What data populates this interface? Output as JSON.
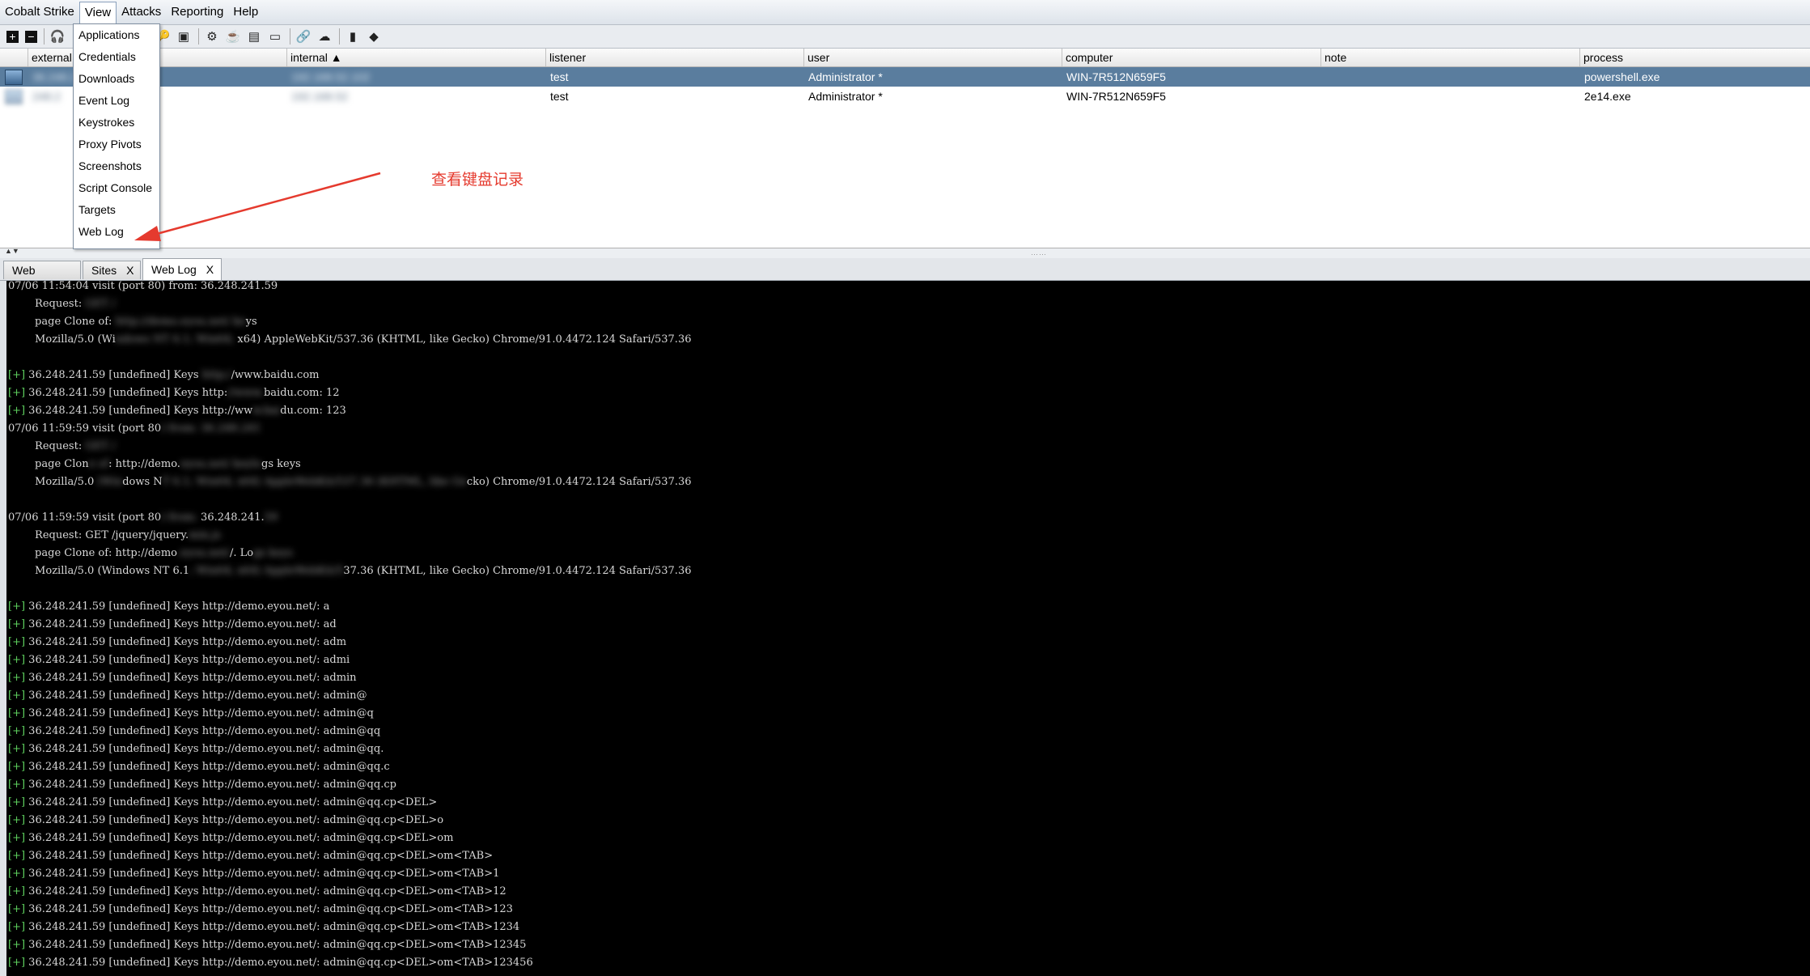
{
  "menubar": {
    "items": [
      "Cobalt Strike",
      "View",
      "Attacks",
      "Reporting",
      "Help"
    ],
    "active": "View"
  },
  "toolbar": {
    "icons": [
      "plus-icon",
      "minus-icon",
      "headphones-icon",
      "share-icon",
      "crosshair-icon",
      "list-icon",
      "download-icon",
      "key-icon",
      "image-icon",
      "gear-icon",
      "coffee-icon",
      "document-icon",
      "terminal-icon",
      "link-icon",
      "cloud-icon",
      "book-icon",
      "cube-icon"
    ]
  },
  "view_menu": {
    "items": [
      "Applications",
      "Credentials",
      "Downloads",
      "Event Log",
      "Keystrokes",
      "Proxy Pivots",
      "Screenshots",
      "Script Console",
      "Targets",
      "Web Log"
    ]
  },
  "sessions": {
    "columns": [
      "external",
      "internal ▲",
      "listener",
      "user",
      "computer",
      "note",
      "process"
    ],
    "rows": [
      {
        "external": "36.248.2",
        "internal": "192.168.52.102",
        "listener": "test",
        "user": "Administrator *",
        "computer": "WIN-7R512N659F5",
        "note": "",
        "process": "powershell.exe",
        "selected": true
      },
      {
        "external": "248.2",
        "internal": "192.168.52",
        "listener": "test",
        "user": "Administrator *",
        "computer": "WIN-7R512N659F5",
        "note": "",
        "process": "2e14.exe",
        "selected": false
      }
    ]
  },
  "tabs": [
    {
      "label": "Web Log",
      "close": "X"
    },
    {
      "label": "Sites",
      "close": "X"
    },
    {
      "label": "Web Log",
      "close": "X",
      "active": true
    }
  ],
  "annotation": {
    "text": "查看键盘记录",
    "color": "#e53a2e"
  },
  "console": {
    "lines": [
      {
        "t": "07/06 11:54:04 visit (port 80) from: 36.248.241.59"
      },
      {
        "t": "        Request: ",
        "b": "GET /"
      },
      {
        "t": "        page Clone of: ",
        "b": "http://demo.eyou.net/ ke",
        "s": "ys"
      },
      {
        "t": "        Mozilla/5.0 (Wi",
        "b": "ndows NT 6.1; Win64;",
        "s": " x64) AppleWebKit/537.36 (KHTML, like Gecko) Chrome/91.0.4472.124 Safari/537.36"
      },
      {
        "t": ""
      },
      {
        "p": "[+]",
        "t": " 36.248.241.59 [undefined] Keys ",
        "b": "http:/",
        "s": "/www.baidu.com"
      },
      {
        "p": "[+]",
        "t": " 36.248.241.59 [undefined] Keys http:",
        "b": "//www.",
        "s": "baidu.com: 12"
      },
      {
        "p": "[+]",
        "t": " 36.248.241.59 [undefined] Keys http://ww",
        "b": "w.bai",
        "s": "du.com: 123"
      },
      {
        "t": "07/06 11:59:59 visit (port 80",
        "b": ") from: 36.248.241",
        "s": ""
      },
      {
        "t": "        Request: ",
        "b": "GET /"
      },
      {
        "t": "        page Clon",
        "b": "e of",
        "s": ": http://demo.",
        "b2": "eyou.net/ keylo",
        "s2": "gs keys"
      },
      {
        "t": "        Mozilla/5.0 ",
        "b": "(Win",
        "s": "dows N",
        "b2": "T 6.1; Win64; x64) AppleWebKit/537.36 (KHTML, like Ge",
        "s2": "cko) Chrome/91.0.4472.124 Safari/537.36"
      },
      {
        "t": ""
      },
      {
        "t": "07/06 11:59:59 visit (port 80",
        "b": ") from: ",
        "s": "36.248.241.",
        "b2": "59"
      },
      {
        "t": "        Request: GET /jquery/jquery.",
        "b": "min.js"
      },
      {
        "t": "        page Clone of: http://demo",
        "b": ".eyou.net/",
        "s": "/. Lo",
        "b2": "gs keys"
      },
      {
        "t": "        Mozilla/5.0 (Windows NT 6.1",
        "b": "; Win64; x64) AppleWebKit/5",
        "s": "37.36 (KHTML, like Gecko) Chrome/91.0.4472.124 Safari/537.36"
      },
      {
        "t": ""
      },
      {
        "p": "[+]",
        "t": " 36.248.241.59 [undefined] Keys http://demo.eyou.net/: a"
      },
      {
        "p": "[+]",
        "t": " 36.248.241.59 [undefined] Keys http://demo.eyou.net/: ad"
      },
      {
        "p": "[+]",
        "t": " 36.248.241.59 [undefined] Keys http://demo.eyou.net/: adm"
      },
      {
        "p": "[+]",
        "t": " 36.248.241.59 [undefined] Keys http://demo.eyou.net/: admi"
      },
      {
        "p": "[+]",
        "t": " 36.248.241.59 [undefined] Keys http://demo.eyou.net/: admin"
      },
      {
        "p": "[+]",
        "t": " 36.248.241.59 [undefined] Keys http://demo.eyou.net/: admin@"
      },
      {
        "p": "[+]",
        "t": " 36.248.241.59 [undefined] Keys http://demo.eyou.net/: admin@q"
      },
      {
        "p": "[+]",
        "t": " 36.248.241.59 [undefined] Keys http://demo.eyou.net/: admin@qq"
      },
      {
        "p": "[+]",
        "t": " 36.248.241.59 [undefined] Keys http://demo.eyou.net/: admin@qq."
      },
      {
        "p": "[+]",
        "t": " 36.248.241.59 [undefined] Keys http://demo.eyou.net/: admin@qq.c"
      },
      {
        "p": "[+]",
        "t": " 36.248.241.59 [undefined] Keys http://demo.eyou.net/: admin@qq.cp"
      },
      {
        "p": "[+]",
        "t": " 36.248.241.59 [undefined] Keys http://demo.eyou.net/: admin@qq.cp<DEL>"
      },
      {
        "p": "[+]",
        "t": " 36.248.241.59 [undefined] Keys http://demo.eyou.net/: admin@qq.cp<DEL>o"
      },
      {
        "p": "[+]",
        "t": " 36.248.241.59 [undefined] Keys http://demo.eyou.net/: admin@qq.cp<DEL>om"
      },
      {
        "p": "[+]",
        "t": " 36.248.241.59 [undefined] Keys http://demo.eyou.net/: admin@qq.cp<DEL>om<TAB>"
      },
      {
        "p": "[+]",
        "t": " 36.248.241.59 [undefined] Keys http://demo.eyou.net/: admin@qq.cp<DEL>om<TAB>1"
      },
      {
        "p": "[+]",
        "t": " 36.248.241.59 [undefined] Keys http://demo.eyou.net/: admin@qq.cp<DEL>om<TAB>12"
      },
      {
        "p": "[+]",
        "t": " 36.248.241.59 [undefined] Keys http://demo.eyou.net/: admin@qq.cp<DEL>om<TAB>123"
      },
      {
        "p": "[+]",
        "t": " 36.248.241.59 [undefined] Keys http://demo.eyou.net/: admin@qq.cp<DEL>om<TAB>1234"
      },
      {
        "p": "[+]",
        "t": " 36.248.241.59 [undefined] Keys http://demo.eyou.net/: admin@qq.cp<DEL>om<TAB>12345"
      },
      {
        "p": "[+]",
        "t": " 36.248.241.59 [undefined] Keys http://demo.eyou.net/: admin@qq.cp<DEL>om<TAB>123456"
      }
    ]
  }
}
